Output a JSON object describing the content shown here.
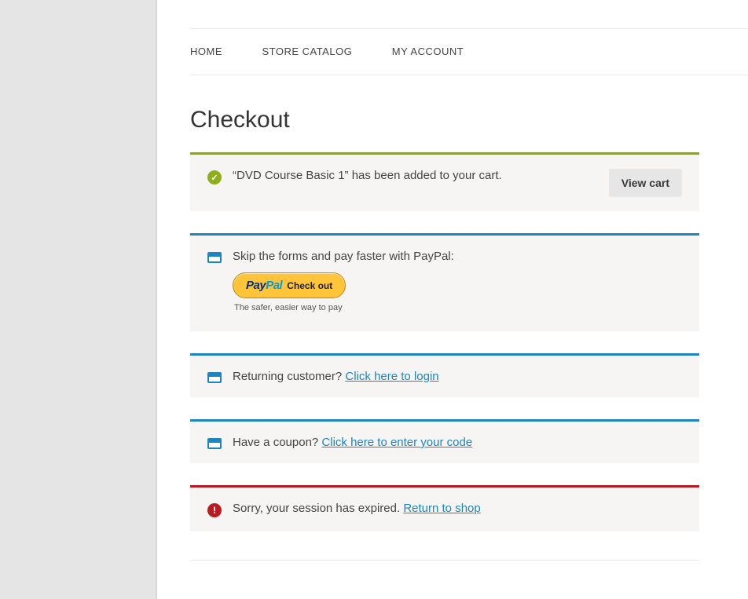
{
  "nav": {
    "home": "HOME",
    "catalog": "STORE CATALOG",
    "account": "MY ACCOUNT"
  },
  "page_title": "Checkout",
  "success_msg": {
    "text": "“DVD Course Basic 1” has been added to your cart.",
    "view_cart_label": "View cart"
  },
  "paypal_msg": {
    "text": "Skip the forms and pay faster with PayPal:",
    "logo": {
      "pay": "Pay",
      "pal": "Pal"
    },
    "checkout_label": "Check out",
    "tagline": "The safer, easier way to pay"
  },
  "login_msg": {
    "prefix": "Returning customer? ",
    "link": "Click here to login"
  },
  "coupon_msg": {
    "prefix": "Have a coupon? ",
    "link": "Click here to enter your code"
  },
  "error_msg": {
    "prefix": "Sorry, your session has expired. ",
    "link": "Return to shop"
  }
}
